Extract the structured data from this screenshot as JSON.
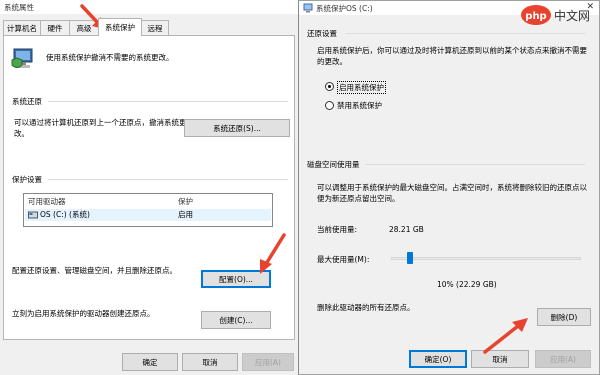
{
  "left_window": {
    "title": "系统属性",
    "tabs": [
      "计算机名",
      "硬件",
      "高级",
      "系统保护",
      "远程"
    ],
    "active_tab": "系统保护",
    "intro_text": "使用系统保护撤消不需要的系统更改。",
    "restore_section": {
      "label": "系统还原",
      "text": "可以通过将计算机还原到上一个还原点，撤消系统更改。",
      "button": "系统还原(S)..."
    },
    "protection_section": {
      "label": "保护设置",
      "columns": [
        "可用驱动器",
        "保护"
      ],
      "rows": [
        {
          "drive": "OS (C:) (系统)",
          "protection": "启用"
        }
      ],
      "config_text": "配置还原设置、管理磁盘空间，并且删除还原点。",
      "config_button": "配置(O)...",
      "create_text": "立刻为启用系统保护的驱动器创建还原点。",
      "create_button": "创建(C)..."
    },
    "footer": {
      "ok": "确定",
      "cancel": "取消",
      "apply": "应用(A)"
    }
  },
  "right_window": {
    "title": "系统保护OS (C:)",
    "close_glyph": "✕",
    "restore_settings": {
      "label": "还原设置",
      "text": "启用系统保护后，你可以通过及时将计算机还原到以前的某个状态点来撤消不需要的更改。",
      "options": [
        "启用系统保护",
        "禁用系统保护"
      ],
      "selected": "启用系统保护"
    },
    "disk_usage": {
      "label": "磁盘空间使用量",
      "text": "可以调整用于系统保护的最大磁盘空间。占满空间时，系统将删除较旧的还原点以便为新还原点留出空间。",
      "current_label": "当前使用量:",
      "current_value": "28.21 GB",
      "max_label": "最大使用量(M):",
      "max_fraction": 0.1,
      "max_readout": "10% (22.29 GB)",
      "delete_text": "删除此驱动器的所有还原点。",
      "delete_button": "删除(D)"
    },
    "footer": {
      "ok": "确定(O)",
      "cancel": "取消",
      "apply": "应用(A)"
    }
  },
  "watermark": {
    "logo": "php",
    "text": "中文网"
  },
  "colors": {
    "accent": "#0078d7",
    "arrow": "#e8432f",
    "watermark_bg": "#e8432f"
  }
}
